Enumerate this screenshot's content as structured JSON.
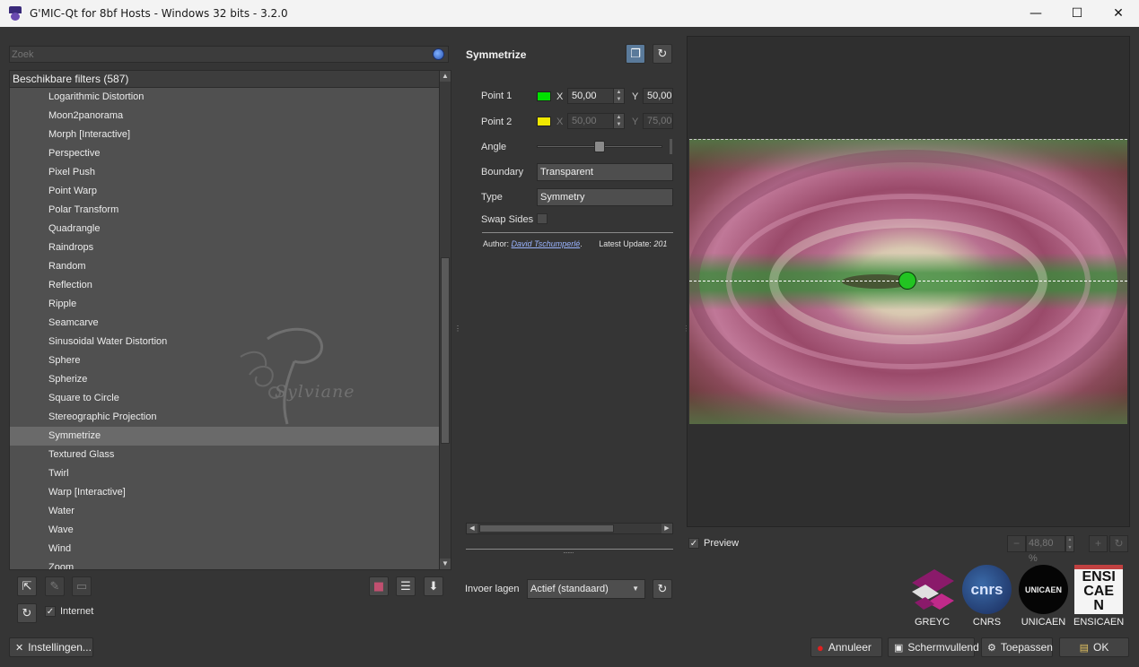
{
  "window": {
    "title": "G'MIC-Qt for 8bf Hosts - Windows 32 bits - 3.2.0",
    "minimize_glyph": "—",
    "maximize_glyph": "☐",
    "close_glyph": "✕"
  },
  "search": {
    "placeholder": "Zoek"
  },
  "filters": {
    "header": "Beschikbare filters (587)",
    "items": [
      "Logarithmic Distortion",
      "Moon2panorama",
      "Morph [Interactive]",
      "Perspective",
      "Pixel Push",
      "Point Warp",
      "Polar Transform",
      "Quadrangle",
      "Raindrops",
      "Random",
      "Reflection",
      "Ripple",
      "Seamcarve",
      "Sinusoidal Water Distortion",
      "Sphere",
      "Spherize",
      "Square to Circle",
      "Stereographic Projection",
      "Symmetrize",
      "Textured Glass",
      "Twirl",
      "Warp [Interactive]",
      "Water",
      "Wave",
      "Wind",
      "Zoom"
    ],
    "selected_index": 18
  },
  "watermark": {
    "text": "Sylviane"
  },
  "left_bottom": {
    "internet_label": "Internet",
    "internet_checked": true,
    "settings_label": "Instellingen..."
  },
  "params": {
    "title": "Symmetrize",
    "point1": {
      "label": "Point 1",
      "color": "#00e000",
      "x_label": "X",
      "x": "50,00",
      "y_label": "Y",
      "y": "50,00"
    },
    "point2": {
      "label": "Point 2",
      "color": "#f0e800",
      "x_label": "X",
      "x": "50,00",
      "y_label": "Y",
      "y": "75,00"
    },
    "angle": {
      "label": "Angle",
      "value_fraction": 0.47
    },
    "boundary": {
      "label": "Boundary",
      "value": "Transparent"
    },
    "type": {
      "label": "Type",
      "value": "Symmetry"
    },
    "swap_sides": {
      "label": "Swap Sides",
      "checked": false
    },
    "author_label": "Author:",
    "author_name": "David Tschumperlé",
    "update_label": "Latest Update:",
    "update_value": "201"
  },
  "input_layers": {
    "label": "Invoer lagen",
    "value": "Actief (standaard)"
  },
  "preview": {
    "label": "Preview",
    "checked": true,
    "zoom": "48,80 %"
  },
  "logos": [
    {
      "name": "GREYC"
    },
    {
      "name": "CNRS",
      "mark": "cnrs"
    },
    {
      "name": "UNICAEN",
      "mark": "UNICAEN"
    },
    {
      "name": "ENSICAEN",
      "mark": "ENSI CAEN"
    }
  ],
  "actions": {
    "cancel": "Annuleer",
    "fullscreen": "Schermvullend",
    "apply": "Toepassen",
    "ok": "OK"
  }
}
